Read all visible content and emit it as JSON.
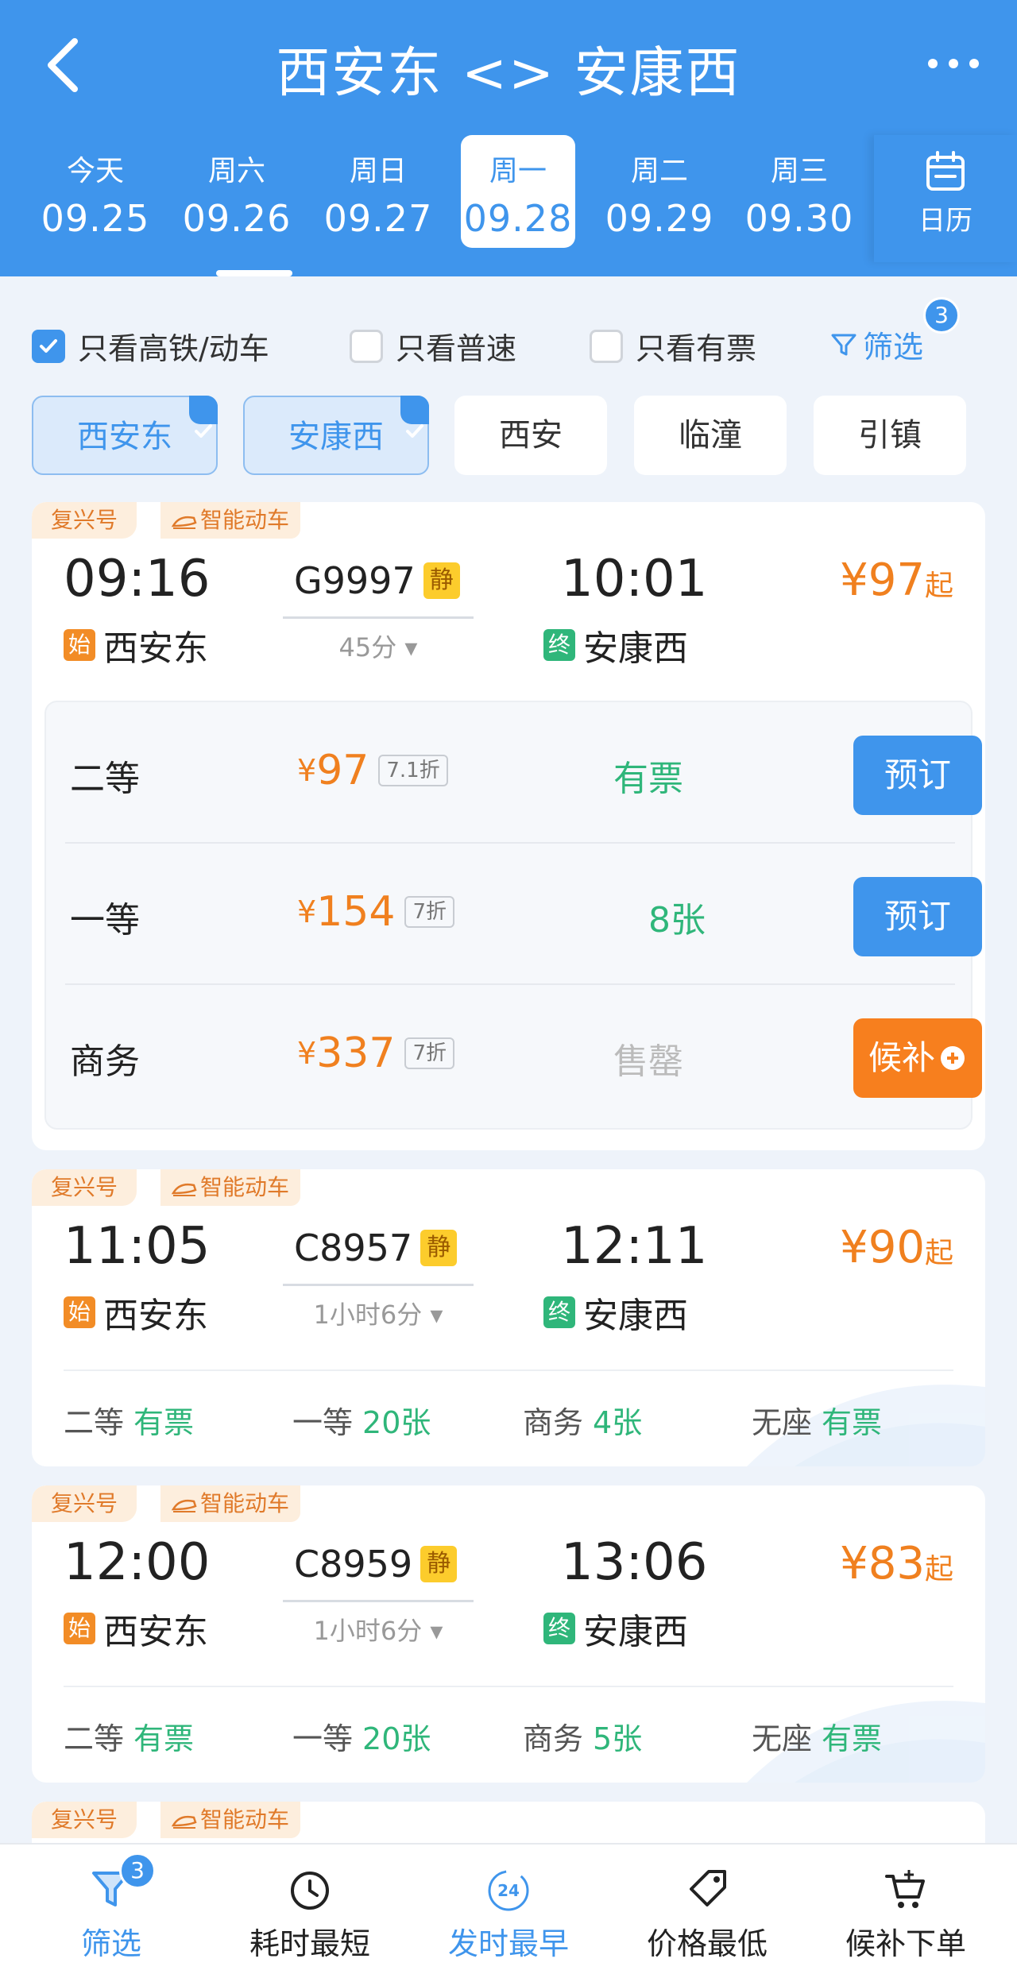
{
  "header": {
    "title": "西安东 <> 安康西",
    "dates": [
      {
        "day": "今天",
        "date": "09.25"
      },
      {
        "day": "周六",
        "date": "09.26"
      },
      {
        "day": "周日",
        "date": "09.27"
      },
      {
        "day": "周一",
        "date": "09.28"
      },
      {
        "day": "周二",
        "date": "09.29"
      },
      {
        "day": "周三",
        "date": "09.30"
      }
    ],
    "calendar_label": "日历"
  },
  "filters": {
    "high_speed": "只看高铁/动车",
    "normal": "只看普速",
    "available": "只看有票",
    "filter_label": "筛选",
    "filter_count": "3"
  },
  "stations": [
    "西安东",
    "安康西",
    "西安",
    "临潼",
    "引镇"
  ],
  "trains": [
    {
      "tag1": "复兴号",
      "tag2": "智能动车",
      "dep_time": "09:16",
      "train_no": "G9997",
      "quiet": "静",
      "arr_time": "10:01",
      "duration": "45分",
      "start_badge": "始",
      "from": "西安东",
      "end_badge": "终",
      "to": "安康西",
      "price": "¥97",
      "price_suffix": "起",
      "seats": [
        {
          "name": "二等",
          "price": "97",
          "discount": "7.1折",
          "status": "有票",
          "action": "预订"
        },
        {
          "name": "一等",
          "price": "154",
          "discount": "7折",
          "status": "8张",
          "action": "预订"
        },
        {
          "name": "商务",
          "price": "337",
          "discount": "7折",
          "status": "售罄",
          "action": "候补"
        }
      ]
    },
    {
      "tag1": "复兴号",
      "tag2": "智能动车",
      "dep_time": "11:05",
      "train_no": "C8957",
      "quiet": "静",
      "arr_time": "12:11",
      "duration": "1小时6分",
      "start_badge": "始",
      "from": "西安东",
      "end_badge": "终",
      "to": "安康西",
      "price": "¥90",
      "price_suffix": "起",
      "summary": [
        {
          "name": "二等",
          "value": "有票"
        },
        {
          "name": "一等",
          "value": "20张"
        },
        {
          "name": "商务",
          "value": "4张"
        },
        {
          "name": "无座",
          "value": "有票"
        }
      ]
    },
    {
      "tag1": "复兴号",
      "tag2": "智能动车",
      "dep_time": "12:00",
      "train_no": "C8959",
      "quiet": "静",
      "arr_time": "13:06",
      "duration": "1小时6分",
      "start_badge": "始",
      "from": "西安东",
      "end_badge": "终",
      "to": "安康西",
      "price": "¥83",
      "price_suffix": "起",
      "summary": [
        {
          "name": "二等",
          "value": "有票"
        },
        {
          "name": "一等",
          "value": "20张"
        },
        {
          "name": "商务",
          "value": "5张"
        },
        {
          "name": "无座",
          "value": "有票"
        }
      ]
    },
    {
      "tag1": "复兴号",
      "tag2": "智能动车"
    }
  ],
  "bottom_tabs": [
    {
      "label": "筛选",
      "badge": "3"
    },
    {
      "label": "耗时最短"
    },
    {
      "label": "发时最早",
      "icon_text": "24"
    },
    {
      "label": "价格最低"
    },
    {
      "label": "候补下单"
    }
  ],
  "colors": {
    "primary": "#3f95ec",
    "price": "#f0801f",
    "available": "#2fb67a",
    "waitlist": "#f77f1e"
  }
}
